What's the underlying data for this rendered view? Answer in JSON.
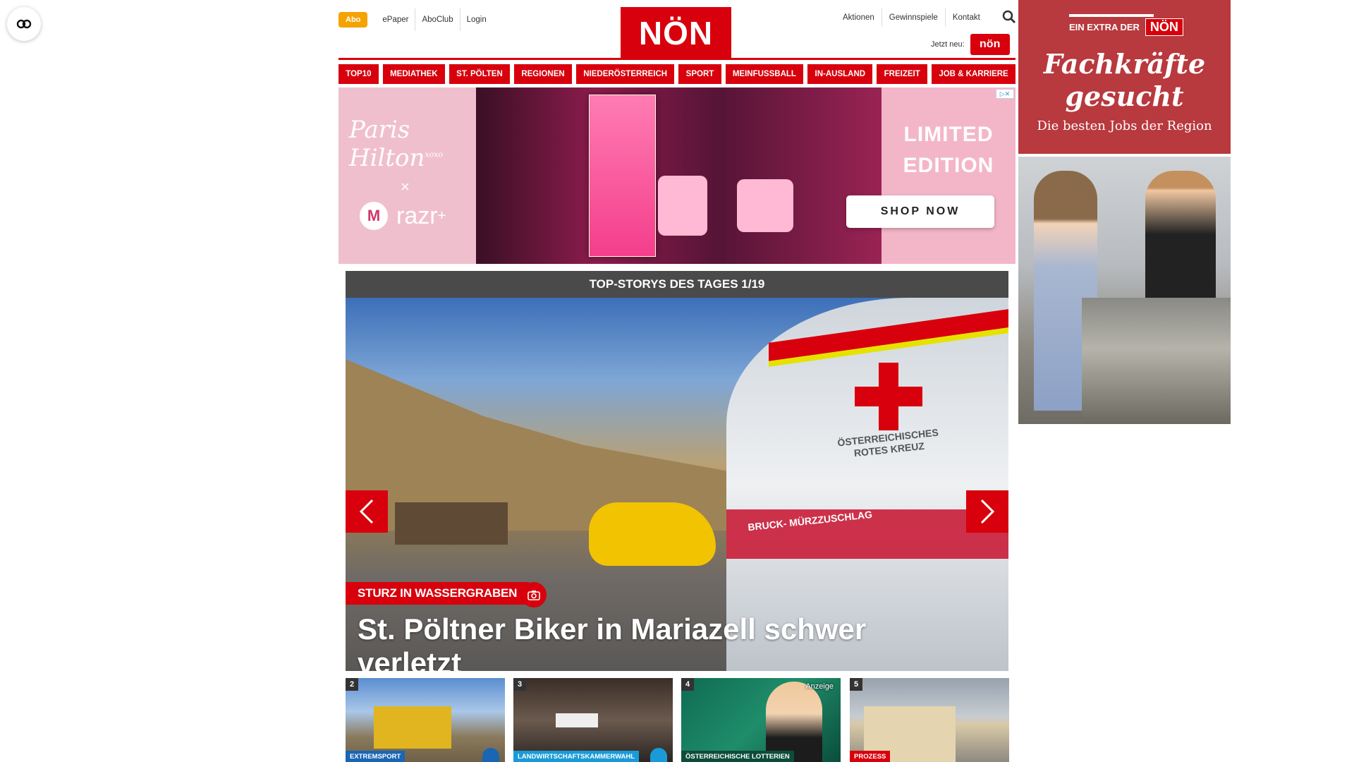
{
  "accessibility": {
    "icon": "accessibility-toggle-icon"
  },
  "util_left": {
    "abo": "Abo",
    "links": [
      "ePaper",
      "AboClub",
      "Login"
    ]
  },
  "logo": "NÖN",
  "util_right": {
    "links": [
      "Aktionen",
      "Gewinnspiele",
      "Kontakt"
    ],
    "jetzt_neu": "Jetzt neu:",
    "mini_logo": "nön"
  },
  "nav": [
    "TOP10",
    "MEDIATHEK",
    "ST. PÖLTEN",
    "REGIONEN",
    "NIEDERÖSTERREICH",
    "SPORT",
    "MEINFUSSBALL",
    "IN-AUSLAND",
    "FREIZEIT",
    "JOB & KARRIERE"
  ],
  "banner": {
    "brand": "Paris Hilton",
    "brand_suffix": "xoxo",
    "x": "×",
    "razr": "razr",
    "razr_plus": "+",
    "limited1": "LIMITED",
    "limited2": "EDITION",
    "shop": "SHOP NOW"
  },
  "slider": {
    "header": "TOP-STORYS DES TAGES 1/19",
    "kicker": "STURZ IN WASSERGRABEN",
    "headline": "St. Pöltner Biker in Mariazell schwer verletzt",
    "van_text": "ÖSTERREICHISCHES ROTES KREUZ",
    "van_text2": "BRUCK- MÜRZZUSCHLAG"
  },
  "thumbs": [
    {
      "num": "2",
      "tag": "EXTREMSPORT",
      "tag_color": "#1a66b3",
      "camera": true
    },
    {
      "num": "3",
      "tag": "LANDWIRTSCHAFTSKAMMERWAHL",
      "tag_color": "#1a9bd7",
      "camera": true
    },
    {
      "num": "4",
      "tag": "ÖSTERREICHISCHE LOTTERIEN",
      "tag_color": "#0d4c3a",
      "anzeige": "Anzeige"
    },
    {
      "num": "5",
      "tag": "PROZESS",
      "tag_color": "#d8000c"
    }
  ],
  "sky": {
    "extra": "EIN EXTRA DER",
    "nn": "NÖN",
    "headline1": "Fachkräfte",
    "headline2": "gesucht",
    "sub": "Die besten Jobs der Region"
  },
  "colors": {
    "brand_red": "#d8000c",
    "abo_orange": "#f5a300",
    "header_gray": "#4a4a4a"
  }
}
